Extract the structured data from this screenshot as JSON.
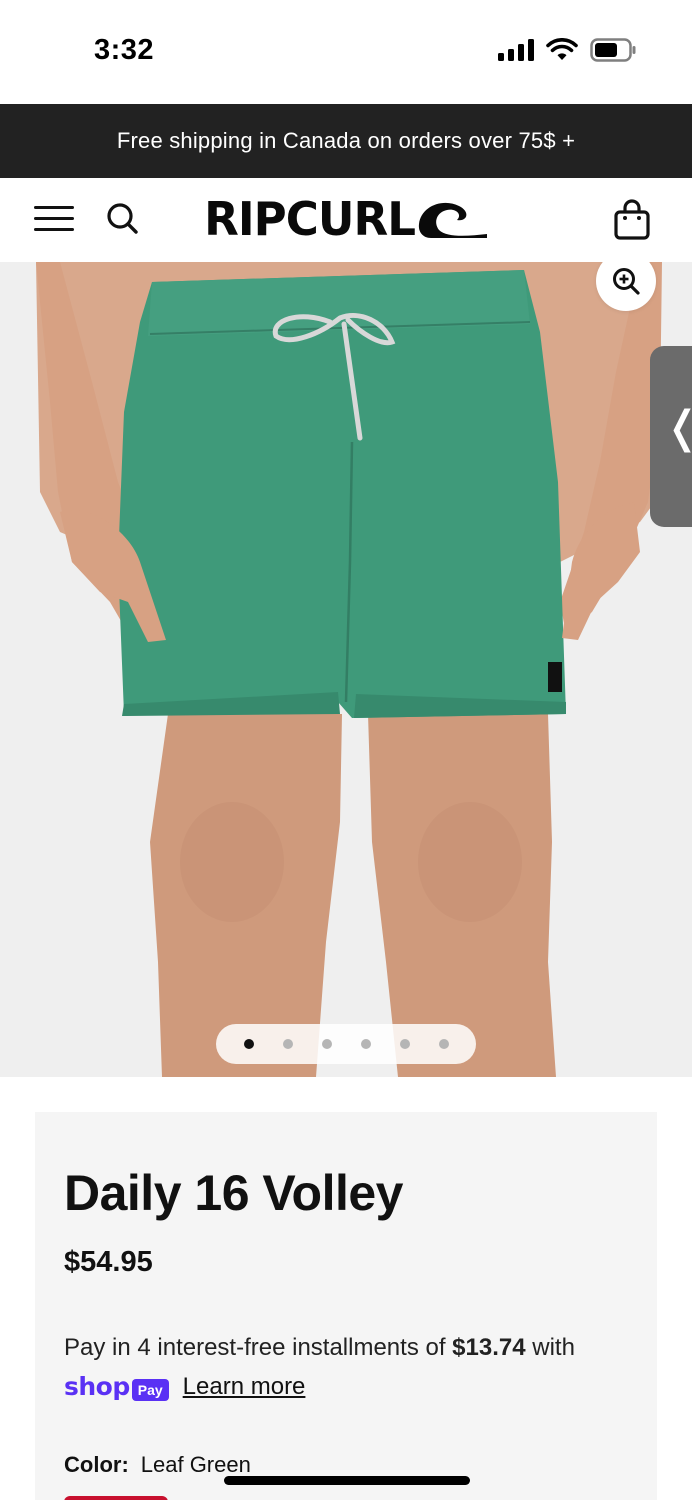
{
  "status_bar": {
    "time": "3:32",
    "icons": [
      "signal-icon",
      "wifi-icon",
      "battery-icon"
    ]
  },
  "promo": {
    "text": "Free shipping in Canada on orders over 75$ +"
  },
  "header": {
    "logo_text": "RIPCURL",
    "icons": [
      "menu-icon",
      "search-icon",
      "shopping-bag-icon"
    ]
  },
  "gallery": {
    "image_alt": "Green volley shorts worn by model",
    "total_images": 6,
    "active_index": 0
  },
  "product": {
    "title": "Daily 16 Volley",
    "price": "$54.95",
    "installments_prefix": "Pay in 4 interest-free installments of ",
    "installment_amount": "$13.74",
    "installments_suffix": " with",
    "shop_pay": {
      "shop_word": "shop",
      "pay_word": "Pay"
    },
    "learn_more": "Learn more",
    "color_label": "Color:",
    "color_value": "Leaf Green"
  },
  "colors": {
    "promo_bg": "#222222",
    "shop_pay": "#5a31f4",
    "shorts": "#3f9a7a",
    "card_bg": "#f5f5f5"
  }
}
